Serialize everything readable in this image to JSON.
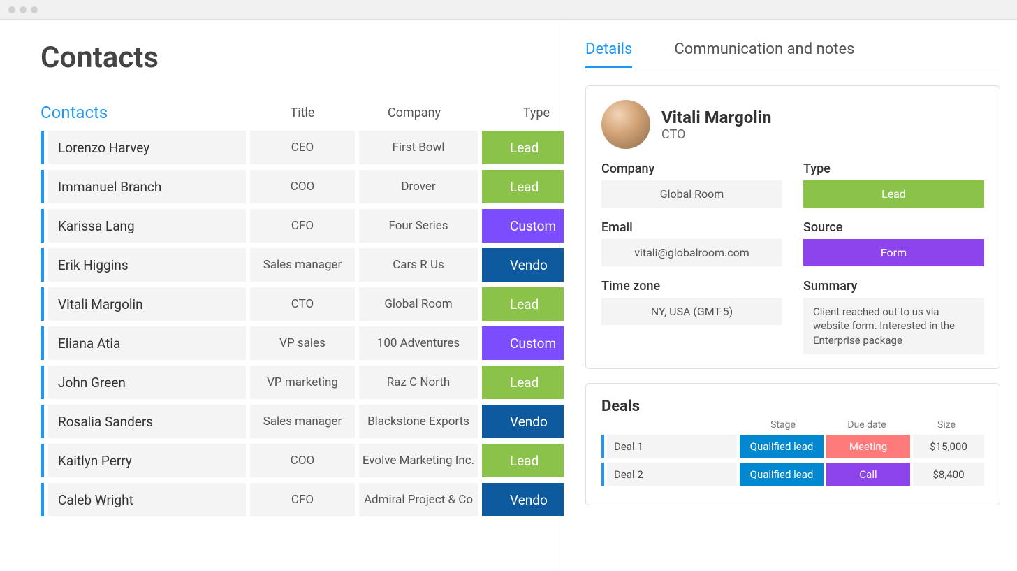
{
  "page_title": "Contacts",
  "section_label": "Contacts",
  "columns": {
    "title": "Title",
    "company": "Company",
    "type": "Type"
  },
  "contacts": [
    {
      "name": "Lorenzo Harvey",
      "title": "CEO",
      "company": "First Bowl",
      "type": "Lead",
      "type_class": "type-lead"
    },
    {
      "name": "Immanuel Branch",
      "title": "COO",
      "company": "Drover",
      "type": "Lead",
      "type_class": "type-lead"
    },
    {
      "name": "Karissa Lang",
      "title": "CFO",
      "company": "Four Series",
      "type": "Custom",
      "type_class": "type-custom"
    },
    {
      "name": "Erik Higgins",
      "title": "Sales manager",
      "company": "Cars R Us",
      "type": "Vendo",
      "type_class": "type-vendo"
    },
    {
      "name": "Vitali Margolin",
      "title": "CTO",
      "company": "Global Room",
      "type": "Lead",
      "type_class": "type-lead"
    },
    {
      "name": "Eliana Atia",
      "title": "VP sales",
      "company": "100 Adventures",
      "type": "Custom",
      "type_class": "type-custom"
    },
    {
      "name": "John Green",
      "title": "VP marketing",
      "company": "Raz C North",
      "type": "Lead",
      "type_class": "type-lead"
    },
    {
      "name": "Rosalia Sanders",
      "title": "Sales manager",
      "company": "Blackstone Exports",
      "type": "Vendo",
      "type_class": "type-vendo"
    },
    {
      "name": "Kaitlyn Perry",
      "title": "COO",
      "company": "Evolve Marketing Inc.",
      "type": "Lead",
      "type_class": "type-lead"
    },
    {
      "name": "Caleb Wright",
      "title": "CFO",
      "company": "Admiral Project & Co",
      "type": "Vendo",
      "type_class": "type-vendo"
    }
  ],
  "tabs": {
    "details": "Details",
    "comm": "Communication and notes"
  },
  "profile": {
    "name": "Vitali Margolin",
    "title": "CTO",
    "labels": {
      "company": "Company",
      "type": "Type",
      "email": "Email",
      "source": "Source",
      "timezone": "Time zone",
      "summary": "Summary"
    },
    "company": "Global Room",
    "type": "Lead",
    "email": "vitali@globalroom.com",
    "source": "Form",
    "timezone": "NY, USA (GMT-5)",
    "summary": "Client reached out to us via website form. Interested in the Enterprise package"
  },
  "deals": {
    "title": "Deals",
    "columns": {
      "stage": "Stage",
      "due": "Due date",
      "size": "Size"
    },
    "rows": [
      {
        "name": "Deal 1",
        "stage": "Qualified lead",
        "due": "Meeting",
        "due_class": "due-meeting",
        "size": "$15,000"
      },
      {
        "name": "Deal 2",
        "stage": "Qualified lead",
        "due": "Call",
        "due_class": "due-call",
        "size": "$8,400"
      }
    ]
  }
}
